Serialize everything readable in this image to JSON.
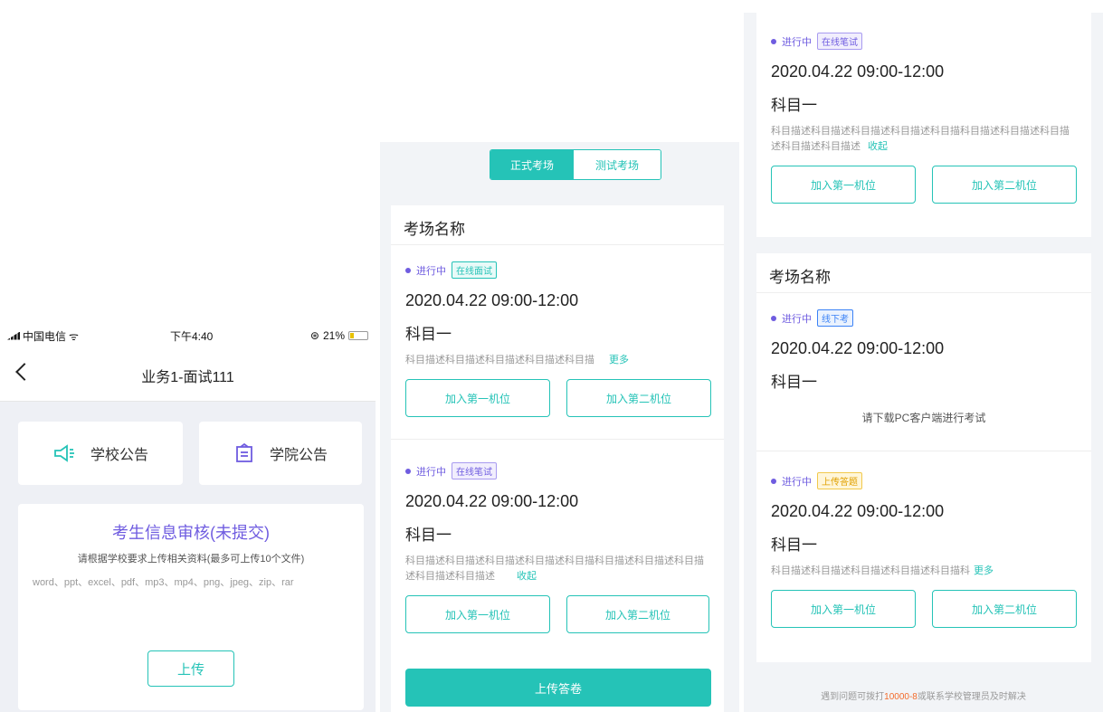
{
  "phone": {
    "status": {
      "carrier": "中国电信",
      "time": "下午4:40",
      "battery": "21%"
    },
    "nav_title": "业务1-面试111",
    "notices": [
      {
        "label": "学校公告",
        "icon": "megaphone-icon"
      },
      {
        "label": "学院公告",
        "icon": "building-icon"
      }
    ],
    "info_card": {
      "title": "考生信息审核(未提交)",
      "subtitle": "请根据学校要求上传相关资料(最多可上传10个文件)",
      "formats": "word、ppt、excel、pdf、mp3、mp4、png、jpeg、zip、rar",
      "upload_label": "上传"
    }
  },
  "panel2": {
    "tabs": {
      "active": "正式考场",
      "inactive": "测试考场"
    },
    "room_name": "考场名称",
    "sessions": [
      {
        "status": "进行中",
        "badge": "在线面试",
        "time": "2020.04.22  09:00-12:00",
        "subject": "科目一",
        "desc": "科目描述科目描述科目描述科目描述科目描",
        "link": "更多",
        "btn1": "加入第一机位",
        "btn2": "加入第二机位"
      },
      {
        "status": "进行中",
        "badge": "在线笔试",
        "time": "2020.04.22  09:00-12:00",
        "subject": "科目一",
        "desc": "科目描述科目描述科目描述科目描述科目描科目描述科目描述科目描述科目描述科目描述",
        "link": "收起",
        "btn1": "加入第一机位",
        "btn2": "加入第二机位"
      }
    ],
    "submit_label": "上传答卷"
  },
  "panel3": {
    "top_session": {
      "status": "进行中",
      "badge": "在线笔试",
      "time": "2020.04.22  09:00-12:00",
      "subject": "科目一",
      "desc": "科目描述科目描述科目描述科目描述科目描科目描述科目描述科目描述科目描述科目描述",
      "link": "收起",
      "btn1": "加入第一机位",
      "btn2": "加入第二机位"
    },
    "room_name": "考场名称",
    "session_a": {
      "status": "进行中",
      "badge": "线下考",
      "time": "2020.04.22  09:00-12:00",
      "subject": "科目一",
      "note": "请下载PC客户端进行考试"
    },
    "session_b": {
      "status": "进行中",
      "badge": "上传答题",
      "time": "2020.04.22  09:00-12:00",
      "subject": "科目一",
      "desc": "科目描述科目描述科目描述科目描述科目描科",
      "link": "更多",
      "btn1": "加入第一机位",
      "btn2": "加入第二机位"
    },
    "help": {
      "prefix": "遇到问题可拨打",
      "phone": "10000-8",
      "suffix": "或联系学校管理员及时解决"
    }
  },
  "colors": {
    "accent": "#25c3b7",
    "purple": "#6f5ce0",
    "warning": "#f36b2c"
  }
}
